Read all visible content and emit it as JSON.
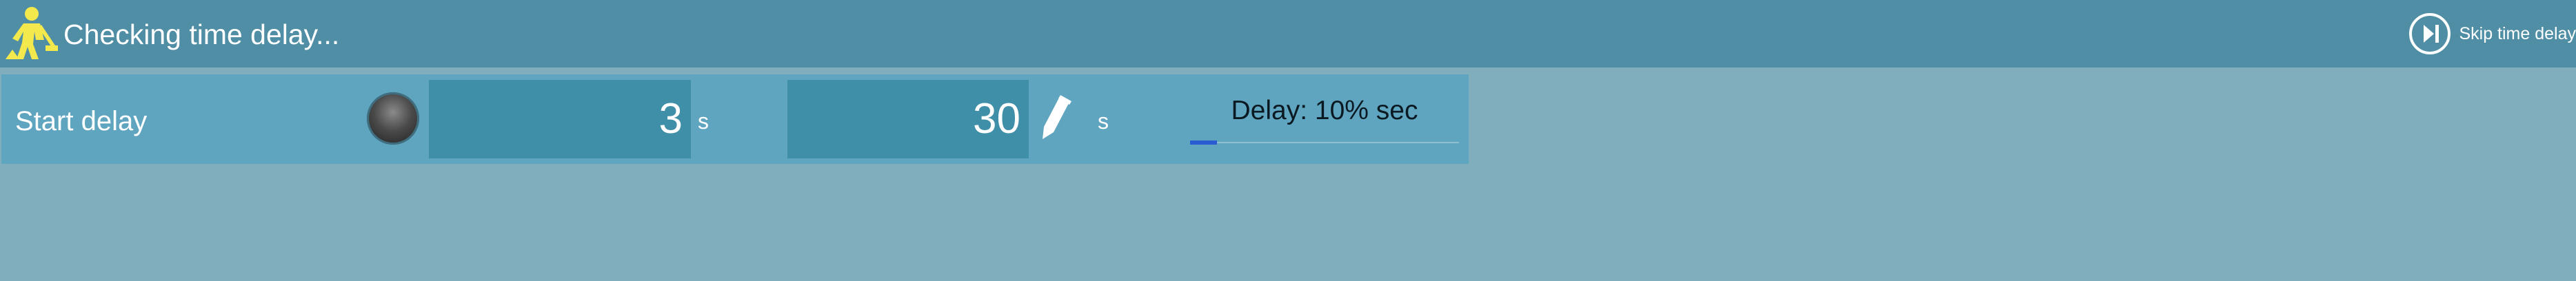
{
  "header": {
    "title": "Checking time delay...",
    "skip_label": "Skip time delay",
    "app_icon": "roadwork-worker-icon",
    "skip_icon": "skip-forward-circle-icon"
  },
  "delay_row": {
    "label": "Start delay",
    "status_led": "off",
    "current_value": "3",
    "current_unit": "s",
    "target_value": "30",
    "target_unit": "s",
    "edit_icon": "pencil-icon",
    "progress_text": "Delay: 10% sec",
    "progress_fraction": 0.1
  },
  "colors": {
    "header_bg": "#4f8ea4",
    "page_bg": "#80aebd",
    "row_bg": "#5fa5bf",
    "value_bg": "#3f8fa8",
    "progress_fill": "#2a5bd0",
    "icon_yellow": "#f4e94c"
  }
}
